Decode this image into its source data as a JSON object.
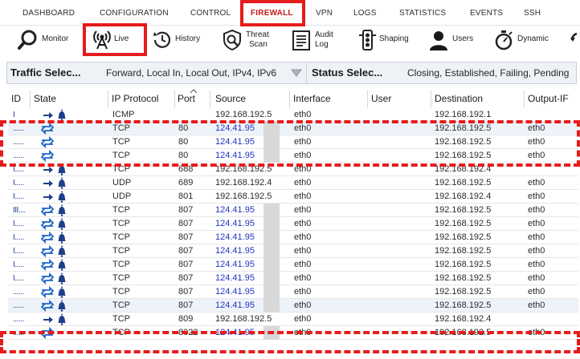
{
  "nav": {
    "items": [
      {
        "label": "DASHBOARD",
        "active": false
      },
      {
        "label": "CONFIGURATION",
        "active": false
      },
      {
        "label": "CONTROL",
        "active": false
      },
      {
        "label": "FIREWALL",
        "active": true
      },
      {
        "label": "VPN",
        "active": false
      },
      {
        "label": "LOGS",
        "active": false
      },
      {
        "label": "STATISTICS",
        "active": false
      },
      {
        "label": "EVENTS",
        "active": false
      },
      {
        "label": "SSH",
        "active": false
      }
    ]
  },
  "toolbar": {
    "items": [
      {
        "label": "Monitor",
        "icon": "magnifier-icon"
      },
      {
        "label": "Live",
        "icon": "antenna-icon",
        "selected": true
      },
      {
        "label": "History",
        "icon": "history-clock-icon"
      },
      {
        "label": "Threat",
        "label2": "Scan",
        "icon": "threat-scan-icon"
      },
      {
        "label": "Audit",
        "label2": "Log",
        "icon": "audit-log-icon"
      },
      {
        "label": "Shaping",
        "icon": "traffic-light-icon"
      },
      {
        "label": "Users",
        "icon": "user-icon"
      },
      {
        "label": "Dynamic",
        "icon": "stopwatch-icon"
      }
    ]
  },
  "filters": {
    "traffic_label": "Traffic Selec...",
    "traffic_value": "Forward, Local In, Local Out, IPv4, IPv6",
    "status_label": "Status Selec...",
    "status_value": "Closing, Established, Failing, Pending"
  },
  "table": {
    "columns": [
      "ID",
      "State",
      "IP Protocol",
      "Port",
      "Source",
      "Interface",
      "User",
      "Destination",
      "Output-IF"
    ],
    "rows": [
      {
        "id": "I",
        "state": "in-alert",
        "protocol": "ICMP",
        "port": "",
        "source": "192.168.192.5",
        "src_link": false,
        "interface": "eth0",
        "user": "",
        "destination": "192.168.192.1",
        "output_if": ""
      },
      {
        "id": "......",
        "state": "both",
        "protocol": "TCP",
        "port": "80",
        "source": "124.41.95",
        "src_link": true,
        "interface": "eth0",
        "user": "",
        "destination": "192.168.192.5",
        "output_if": "eth0"
      },
      {
        "id": "......",
        "state": "both",
        "protocol": "TCP",
        "port": "80",
        "source": "124.41.95",
        "src_link": true,
        "interface": "eth0",
        "user": "",
        "destination": "192.168.192.5",
        "output_if": "eth0"
      },
      {
        "id": "......",
        "state": "both",
        "protocol": "TCP",
        "port": "80",
        "source": "124.41.95",
        "src_link": true,
        "interface": "eth0",
        "user": "",
        "destination": "192.168.192.5",
        "output_if": "eth0"
      },
      {
        "id": "I.....",
        "state": "in-alert",
        "protocol": "TCP",
        "port": "688",
        "source": "192.168.192.5",
        "src_link": false,
        "interface": "eth0",
        "user": "",
        "destination": "192.168.192.4",
        "output_if": ""
      },
      {
        "id": "I.....",
        "state": "in-alert",
        "protocol": "UDP",
        "port": "689",
        "source": "192.168.192.4",
        "src_link": false,
        "interface": "eth0",
        "user": "",
        "destination": "192.168.192.5",
        "output_if": "eth0"
      },
      {
        "id": "I.....",
        "state": "in-alert",
        "protocol": "UDP",
        "port": "801",
        "source": "192.168.192.5",
        "src_link": false,
        "interface": "eth0",
        "user": "",
        "destination": "192.168.192.4",
        "output_if": "eth0"
      },
      {
        "id": "III....",
        "state": "both-alert",
        "protocol": "TCP",
        "port": "807",
        "source": "124.41.95",
        "src_link": true,
        "interface": "eth0",
        "user": "",
        "destination": "192.168.192.5",
        "output_if": "eth0"
      },
      {
        "id": "I.....",
        "state": "both-alert",
        "protocol": "TCP",
        "port": "807",
        "source": "124.41.95",
        "src_link": true,
        "interface": "eth0",
        "user": "",
        "destination": "192.168.192.5",
        "output_if": "eth0"
      },
      {
        "id": "I.....",
        "state": "both-alert",
        "protocol": "TCP",
        "port": "807",
        "source": "124.41.95",
        "src_link": true,
        "interface": "eth0",
        "user": "",
        "destination": "192.168.192.5",
        "output_if": "eth0"
      },
      {
        "id": "I.....",
        "state": "both-alert",
        "protocol": "TCP",
        "port": "807",
        "source": "124.41.95",
        "src_link": true,
        "interface": "eth0",
        "user": "",
        "destination": "192.168.192.5",
        "output_if": "eth0"
      },
      {
        "id": "I.....",
        "state": "both-alert",
        "protocol": "TCP",
        "port": "807",
        "source": "124.41.95",
        "src_link": true,
        "interface": "eth0",
        "user": "",
        "destination": "192.168.192.5",
        "output_if": "eth0"
      },
      {
        "id": "I.....",
        "state": "both-alert",
        "protocol": "TCP",
        "port": "807",
        "source": "124.41.95",
        "src_link": true,
        "interface": "eth0",
        "user": "",
        "destination": "192.168.192.5",
        "output_if": "eth0"
      },
      {
        "id": "......",
        "state": "both-alert",
        "protocol": "TCP",
        "port": "807",
        "source": "124.41.95",
        "src_link": true,
        "interface": "eth0",
        "user": "",
        "destination": "192.168.192.5",
        "output_if": "eth0"
      },
      {
        "id": "......",
        "state": "both-alert",
        "protocol": "TCP",
        "port": "807",
        "source": "124.41.95",
        "src_link": true,
        "interface": "eth0",
        "user": "",
        "destination": "192.168.192.5",
        "output_if": "eth0"
      },
      {
        "id": "......",
        "state": "in-alert",
        "protocol": "TCP",
        "port": "809",
        "source": "192.168.192.5",
        "src_link": false,
        "interface": "eth0",
        "user": "",
        "destination": "192.168.192.4",
        "output_if": ""
      },
      {
        "id": "......",
        "state": "both",
        "protocol": "TCP",
        "port": "8022",
        "source": "124.41.95",
        "src_link": true,
        "interface": "eth0",
        "user": "",
        "destination": "192.168.192.5",
        "output_if": "eth0"
      }
    ]
  },
  "colors": {
    "highlight": "#e51c1c",
    "arrow_blue": "#1f66c7",
    "bell_blue": "#1d3f8a",
    "link_blue": "#2233c0"
  }
}
